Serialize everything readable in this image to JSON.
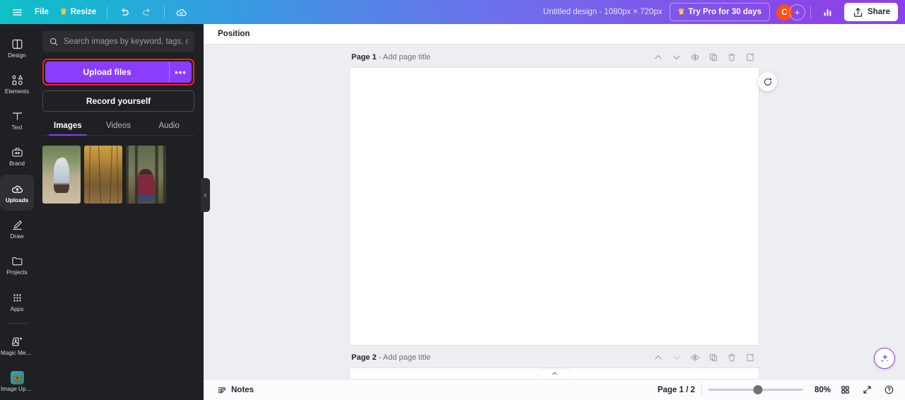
{
  "topbar": {
    "menu_icon": "hamburger-icon",
    "file_label": "File",
    "resize_label": "Resize",
    "resize_crown": "♛",
    "undo_icon": "undo-icon",
    "redo_icon": "redo-icon",
    "cloud_icon": "cloud-saved-icon",
    "doc_title": "Untitled design - 1080px × 720px",
    "try_pro_label": "Try Pro for 30 days",
    "try_pro_crown": "♛",
    "avatar_initial": "C",
    "avatar_color": "#ff4d17",
    "plus_label": "+",
    "insights_icon": "insights-bar-chart-icon",
    "share_label": "Share",
    "share_icon": "share-upload-icon",
    "gradient_start": "#0fc1c6",
    "gradient_end": "#8e3fe6"
  },
  "rail": {
    "items": [
      {
        "label": "Design",
        "icon": "design-layout-icon",
        "active": false
      },
      {
        "label": "Elements",
        "icon": "elements-shapes-icon",
        "active": false
      },
      {
        "label": "Text",
        "icon": "text-t-icon",
        "active": false
      },
      {
        "label": "Brand",
        "icon": "brand-kit-icon",
        "active": false
      },
      {
        "label": "Uploads",
        "icon": "uploads-cloud-icon",
        "active": true
      },
      {
        "label": "Draw",
        "icon": "draw-pen-icon",
        "active": false
      },
      {
        "label": "Projects",
        "icon": "projects-folder-icon",
        "active": false
      },
      {
        "label": "Apps",
        "icon": "apps-grid-icon",
        "active": false
      },
      {
        "label": "Magic Med...",
        "icon": "magic-media-icon",
        "active": false
      },
      {
        "label": "Image Ups...",
        "icon": "image-upscaler-icon",
        "active": false
      }
    ],
    "active_color": "#2e2f33"
  },
  "panel": {
    "search": {
      "placeholder": "Search images by keyword, tags, color...",
      "value": "",
      "icon": "search-icon"
    },
    "upload_button": {
      "label": "Upload files",
      "more_label": "•••",
      "color": "#8b3dff",
      "highlight_color": "#ff1a1a"
    },
    "record_button": {
      "label": "Record yourself"
    },
    "tabs": [
      {
        "label": "Images",
        "active": true
      },
      {
        "label": "Videos",
        "active": false
      },
      {
        "label": "Audio",
        "active": false
      }
    ],
    "thumbnails": [
      {
        "name": "girl-with-camera-photo"
      },
      {
        "name": "autumn-forest-path-photo"
      },
      {
        "name": "woman-in-forest-photo"
      }
    ],
    "collapse_handle_icon": "chevron-left-icon"
  },
  "main": {
    "position_button": "Position",
    "comment_icon": "add-comment-icon",
    "show_pill_icon": "chevron-up-icon",
    "magic_icon": "magic-assistant-sparkle-icon",
    "pages": [
      {
        "title_prefix": "Page 1",
        "title_separator": "-",
        "title_placeholder": "Add page title",
        "tools": [
          {
            "name": "move-page-up-button",
            "icon": "chevron-up-icon",
            "dim": false
          },
          {
            "name": "move-page-down-button",
            "icon": "chevron-down-icon",
            "dim": false
          },
          {
            "name": "hide-page-button",
            "icon": "eye-slash-icon",
            "dim": false
          },
          {
            "name": "duplicate-page-button",
            "icon": "duplicate-icon",
            "dim": false
          },
          {
            "name": "delete-page-button",
            "icon": "trash-icon",
            "dim": false
          },
          {
            "name": "add-page-button",
            "icon": "add-page-icon",
            "dim": false
          }
        ]
      },
      {
        "title_prefix": "Page 2",
        "title_separator": "-",
        "title_placeholder": "Add page title",
        "tools": [
          {
            "name": "move-page-up-button",
            "icon": "chevron-up-icon",
            "dim": false
          },
          {
            "name": "move-page-down-button",
            "icon": "chevron-down-icon",
            "dim": true
          },
          {
            "name": "hide-page-button",
            "icon": "eye-slash-icon",
            "dim": false
          },
          {
            "name": "duplicate-page-button",
            "icon": "duplicate-icon",
            "dim": false
          },
          {
            "name": "delete-page-button",
            "icon": "trash-icon",
            "dim": false
          },
          {
            "name": "add-page-button",
            "icon": "add-page-icon",
            "dim": false
          }
        ]
      }
    ]
  },
  "bottombar": {
    "notes_label": "Notes",
    "notes_icon": "notes-icon",
    "page_count": "Page 1 / 2",
    "zoom_value": "80%",
    "zoom_percent": 80,
    "grid_icon": "grid-view-icon",
    "fullscreen_icon": "fullscreen-icon",
    "help_icon": "help-question-icon"
  }
}
